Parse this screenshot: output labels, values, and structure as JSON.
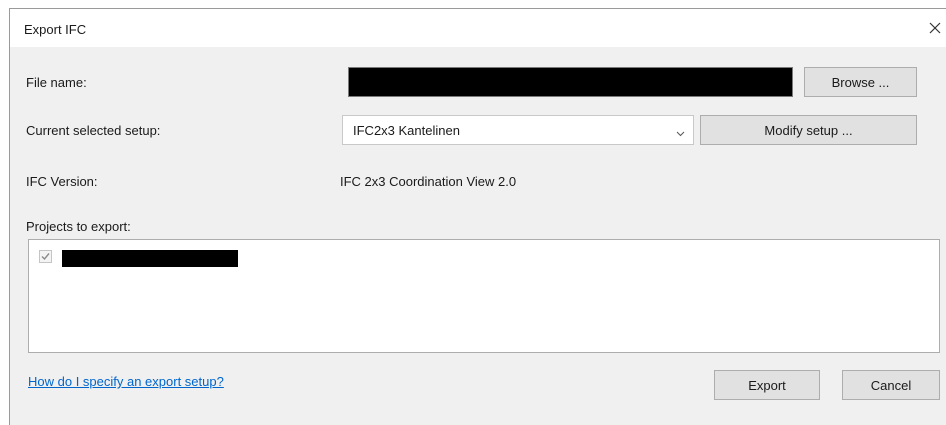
{
  "dialog": {
    "title": "Export IFC"
  },
  "file_name": {
    "label": "File name:",
    "browse_label": "Browse ..."
  },
  "setup": {
    "label": "Current selected setup:",
    "selected": "IFC2x3 Kantelinen",
    "modify_label": "Modify setup ..."
  },
  "ifc_version": {
    "label": "IFC Version:",
    "value": "IFC 2x3 Coordination View 2.0"
  },
  "projects": {
    "label": "Projects to export:",
    "items": [
      {
        "checked": true
      }
    ]
  },
  "footer": {
    "help_link": "How do I specify an export setup?",
    "export_label": "Export",
    "cancel_label": "Cancel"
  },
  "colors": {
    "link": "#0066cc",
    "dialog_bg": "#f0f0f0",
    "button_bg": "#e1e1e1"
  }
}
